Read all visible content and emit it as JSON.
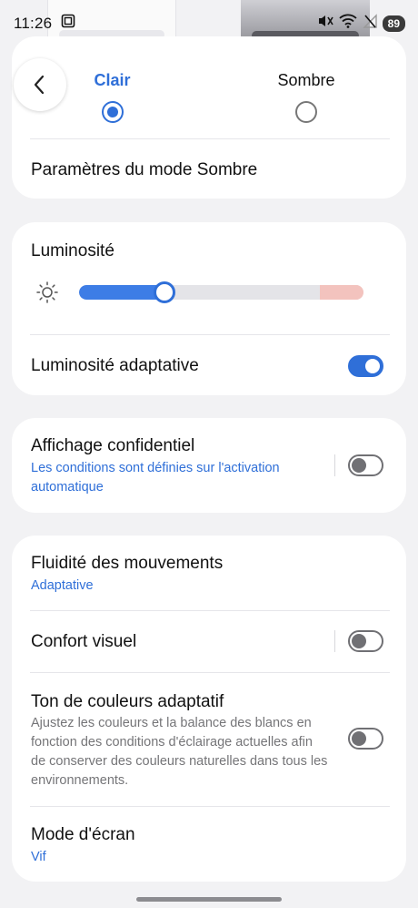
{
  "status_bar": {
    "time": "11:26",
    "battery": "89",
    "icons": [
      "screenshot-icon",
      "mute-icon",
      "wifi-icon",
      "no-signal-icon"
    ]
  },
  "theme": {
    "light_label": "Clair",
    "dark_label": "Sombre",
    "selected": "light",
    "dark_mode_settings": "Paramètres du mode Sombre"
  },
  "brightness": {
    "title": "Luminosité",
    "level": 0.3,
    "adaptive_label": "Luminosité adaptative",
    "adaptive_on": true
  },
  "privacy_display": {
    "title": "Affichage confidentiel",
    "subtitle": "Les conditions sont définies sur l'activation automatique",
    "on": false
  },
  "motion": {
    "title": "Fluidité des mouvements",
    "value": "Adaptative"
  },
  "eye_comfort": {
    "title": "Confort visuel",
    "on": false
  },
  "adaptive_color": {
    "title": "Ton de couleurs adaptatif",
    "description": "Ajustez les couleurs et la balance des blancs en fonction des conditions d'éclairage actuelles afin de conserver des couleurs naturelles dans tous les environnements.",
    "on": false
  },
  "screen_mode": {
    "title": "Mode d'écran",
    "value": "Vif"
  },
  "colors": {
    "accent": "#2f6fd8",
    "background": "#f2f2f4",
    "card": "#ffffff"
  }
}
